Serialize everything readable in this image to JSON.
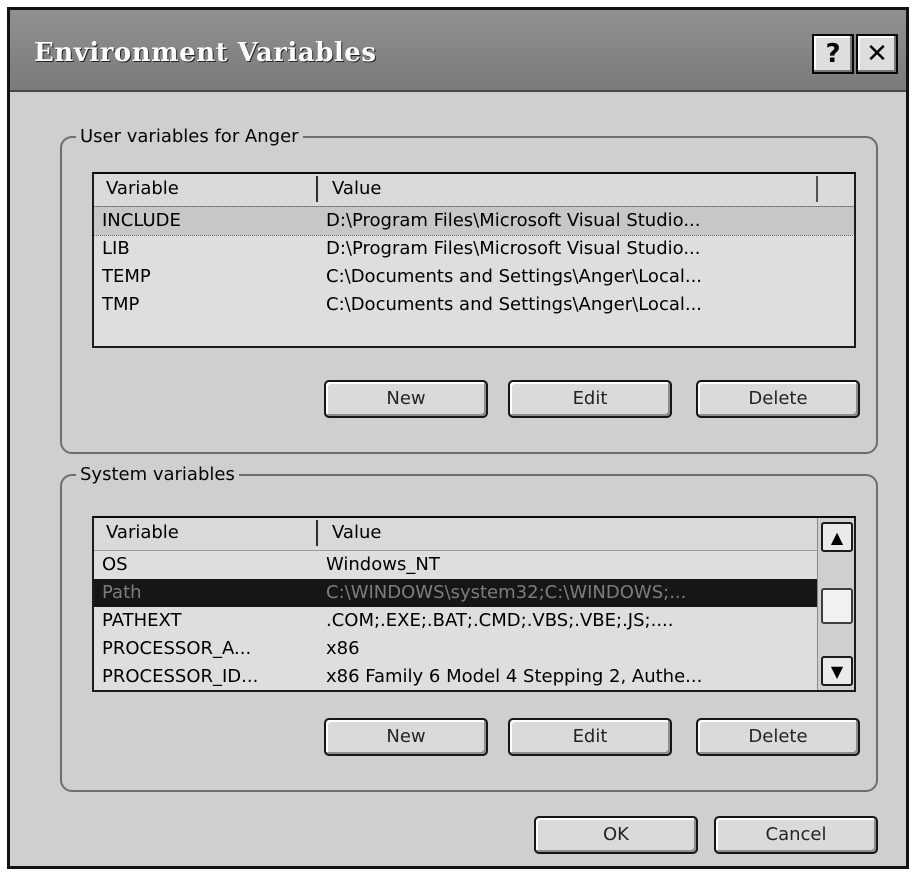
{
  "window": {
    "title": "Environment Variables",
    "help_glyph": "?",
    "close_glyph": "✕"
  },
  "user_vars": {
    "legend": "User variables for Anger",
    "columns": [
      "Variable",
      "Value"
    ],
    "rows": [
      {
        "variable": "INCLUDE",
        "value": "D:\\Program Files\\Microsoft Visual Studio..."
      },
      {
        "variable": "LIB",
        "value": "D:\\Program Files\\Microsoft Visual Studio..."
      },
      {
        "variable": "TEMP",
        "value": "C:\\Documents and Settings\\Anger\\Local..."
      },
      {
        "variable": "TMP",
        "value": "C:\\Documents and Settings\\Anger\\Local..."
      }
    ],
    "selected_index": 0,
    "buttons": {
      "new": "New",
      "edit": "Edit",
      "delete": "Delete"
    }
  },
  "system_vars": {
    "legend": "System variables",
    "columns": [
      "Variable",
      "Value"
    ],
    "rows": [
      {
        "variable": "OS",
        "value": "Windows_NT"
      },
      {
        "variable": "Path",
        "value": "C:\\WINDOWS\\system32;C:\\WINDOWS;..."
      },
      {
        "variable": "PATHEXT",
        "value": ".COM;.EXE;.BAT;.CMD;.VBS;.VBE;.JS;...."
      },
      {
        "variable": "PROCESSOR_A...",
        "value": "x86"
      },
      {
        "variable": "PROCESSOR_ID...",
        "value": "x86 Family 6 Model 4 Stepping 2, Authe..."
      }
    ],
    "selected_index": 1,
    "scroll_up_glyph": "▲",
    "scroll_down_glyph": "▼",
    "buttons": {
      "new": "New",
      "edit": "Edit",
      "delete": "Delete"
    }
  },
  "footer": {
    "ok": "OK",
    "cancel": "Cancel"
  },
  "icons": {
    "help": "help-icon",
    "close": "close-icon",
    "scroll_up": "chevron-up-icon",
    "scroll_down": "chevron-down-icon"
  }
}
